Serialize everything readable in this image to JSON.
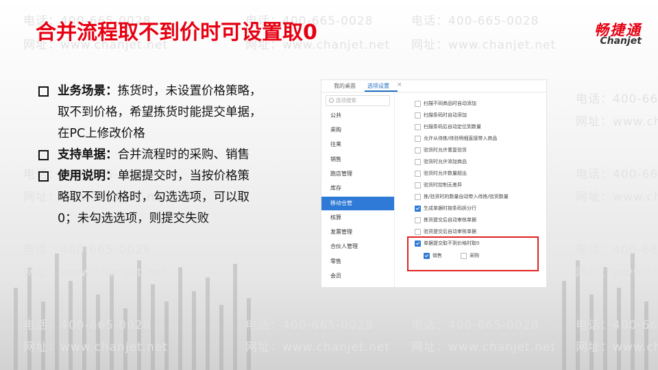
{
  "slide": {
    "title": "合并流程取不到价时可设置取0"
  },
  "logo": {
    "cn": "畅捷通",
    "en": "Chanjet"
  },
  "watermark": {
    "phone": "电话：400-665-0028",
    "site": "网址：www.chanjet.net"
  },
  "bullets": [
    {
      "label": "业务场景：",
      "text": "拣货时，未设置价格策略，",
      "cont": [
        "取不到价格，希望拣货时能提交单据，",
        "在PC上修改价格"
      ]
    },
    {
      "label": "支持单据：",
      "text": "合并流程时的采购、销售",
      "cont": []
    },
    {
      "label": "使用说明：",
      "text": "单据提交时，当按价格策",
      "cont": [
        "略取不到价格时，勾选选项，可以取",
        "0；未勾选选项，则提交失败"
      ]
    }
  ],
  "screenshot": {
    "tabs": [
      {
        "label": "我的桌面"
      },
      {
        "label": "选项设置"
      }
    ],
    "tab_close": "×",
    "search_placeholder": "选项搜索",
    "sidebar": [
      "公共",
      "采购",
      "往来",
      "销售",
      "跑店管理",
      "库存",
      "移动仓管",
      "核算",
      "发票管理",
      "合伙人管理",
      "零售",
      "会员"
    ],
    "sidebar_active": "移动仓管",
    "options": [
      {
        "label": "扫描不同商品时自动添加",
        "checked": false
      },
      {
        "label": "扫描条码时自动添加",
        "checked": false
      },
      {
        "label": "扫描条码后自动定位到数量",
        "checked": false
      },
      {
        "label": "允许从待拣/待验明细直接带入商品",
        "checked": false
      },
      {
        "label": "验货时允许重复验货",
        "checked": false
      },
      {
        "label": "验货时允许添加商品",
        "checked": false
      },
      {
        "label": "验货时允许数量超出",
        "checked": false
      },
      {
        "label": "验货时控制无差异",
        "checked": false
      },
      {
        "label": "拣/验货时的数量自动带入待拣/验货数量",
        "checked": false
      },
      {
        "label": "生成单据时按条码拆分行",
        "checked": true
      },
      {
        "label": "拣货提交后自动审核单据",
        "checked": false
      },
      {
        "label": "验货提交后自动审核单据",
        "checked": false
      },
      {
        "label": "单据提交取不到价格时取0",
        "checked": true
      }
    ],
    "sub_options": [
      {
        "label": "销售",
        "checked": true
      },
      {
        "label": "采购",
        "checked": false
      }
    ]
  },
  "colors": {
    "brand_red": "#e60012",
    "accent_blue": "#2f7ad6",
    "highlight_red": "#e02020"
  }
}
